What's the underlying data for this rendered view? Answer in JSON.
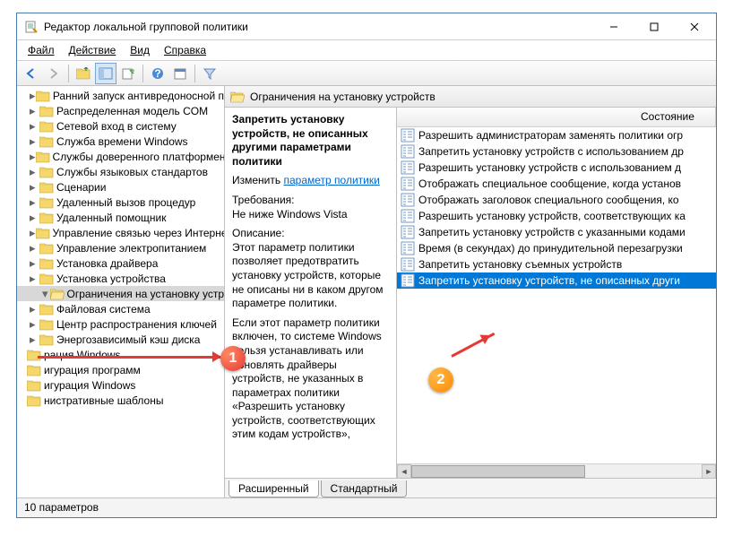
{
  "window": {
    "title": "Редактор локальной групповой политики"
  },
  "menu": {
    "file": "Файл",
    "action": "Действие",
    "view": "Вид",
    "help": "Справка"
  },
  "tree": [
    {
      "label": "Ранний запуск антивредоносной п",
      "indent": 0
    },
    {
      "label": "Распределенная модель COM",
      "indent": 0
    },
    {
      "label": "Сетевой вход в систему",
      "indent": 0
    },
    {
      "label": "Служба времени Windows",
      "indent": 0
    },
    {
      "label": "Службы доверенного платформен",
      "indent": 0
    },
    {
      "label": "Службы языковых стандартов",
      "indent": 0
    },
    {
      "label": "Сценарии",
      "indent": 0
    },
    {
      "label": "Удаленный вызов процедур",
      "indent": 0
    },
    {
      "label": "Удаленный помощник",
      "indent": 0
    },
    {
      "label": "Управление связью через Интерне",
      "indent": 0
    },
    {
      "label": "Управление электропитанием",
      "indent": 0
    },
    {
      "label": "Установка драйвера",
      "indent": 0
    },
    {
      "label": "Установка устройства",
      "indent": 0
    },
    {
      "label": "Ограничения на установку устр",
      "indent": 1,
      "selected": true,
      "open": true
    },
    {
      "label": "Файловая система",
      "indent": 0
    },
    {
      "label": "Центр распространения ключей",
      "indent": 0
    },
    {
      "label": "Энергозависимый кэш диска",
      "indent": 0
    },
    {
      "label": "рация Windows",
      "indent": -1
    },
    {
      "label": "игурация программ",
      "indent": -1
    },
    {
      "label": "игурация Windows",
      "indent": -1
    },
    {
      "label": "нистративные шаблоны",
      "indent": -1
    }
  ],
  "panel_header": "Ограничения на установку устройств",
  "detail": {
    "title": "Запретить установку устройств, не описанных другими параметрами политики",
    "change_label": "Изменить",
    "change_link": "параметр политики",
    "req_label": "Требования:",
    "req_value": "Не ниже Windows Vista",
    "desc_label": "Описание:",
    "desc1": "Этот параметр политики позволяет предотвратить установку устройств, которые не описаны ни в каком другом параметре политики.",
    "desc2": "Если этот параметр политики включен, то системе Windows нельзя устанавливать или обновлять драйверы устройств, не указанных в параметрах политики «Разрешить установку устройств, соответствующих этим кодам устройств»,"
  },
  "list": {
    "col_state": "Состояние",
    "items": [
      "Разрешить администраторам заменять политики огр",
      "Запретить установку устройств с использованием др",
      "Разрешить установку устройств с использованием д",
      "Отображать специальное сообщение, когда установ",
      "Отображать заголовок специального сообщения, ко",
      "Разрешить установку устройств, соответствующих ка",
      "Запретить установку устройств с указанными кодами",
      "Время (в секундах) до принудительной перезагрузки",
      "Запретить установку съемных устройств",
      "Запретить установку устройств, не описанных други"
    ],
    "selected_index": 9
  },
  "tabs": {
    "extended": "Расширенный",
    "standard": "Стандартный"
  },
  "statusbar": "10 параметров",
  "badges": {
    "one": "1",
    "two": "2"
  }
}
